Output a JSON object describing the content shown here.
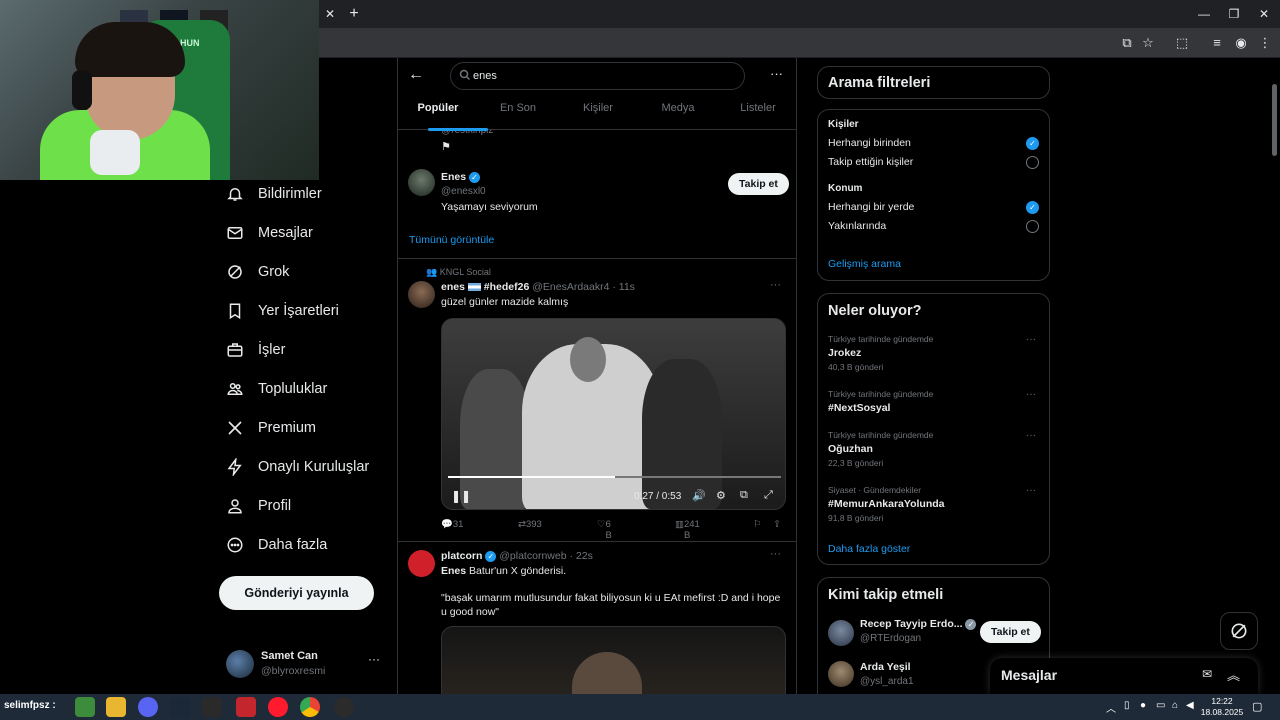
{
  "search": {
    "query": "enes"
  },
  "tabs": [
    "Popüler",
    "En Son",
    "Kişiler",
    "Medya",
    "Listeler"
  ],
  "nav": {
    "items": [
      {
        "label": "Bildirimler",
        "icon": "bell-icon"
      },
      {
        "label": "Mesajlar",
        "icon": "mail-icon"
      },
      {
        "label": "Grok",
        "icon": "grok-icon"
      },
      {
        "label": "Yer İşaretleri",
        "icon": "bookmark-icon"
      },
      {
        "label": "İşler",
        "icon": "briefcase-icon"
      },
      {
        "label": "Topluluklar",
        "icon": "communities-icon"
      },
      {
        "label": "Premium",
        "icon": "x-logo-icon"
      },
      {
        "label": "Onaylı Kuruluşlar",
        "icon": "lightning-icon"
      },
      {
        "label": "Profil",
        "icon": "person-icon"
      },
      {
        "label": "Daha fazla",
        "icon": "more-circle-icon"
      }
    ],
    "post_button": "Gönderiyi yayınla",
    "account": {
      "name": "Samet Can",
      "handle": "@blyroxresmi"
    }
  },
  "people_results": {
    "partial_handle": "@restkinplz",
    "user": {
      "name": "Enes",
      "handle": "@enesxl0",
      "bio": "Yaşamayı seviyorum",
      "follow_label": "Takip et"
    },
    "show_all": "Tümünü görüntüle"
  },
  "post1": {
    "community": "KNGL Social",
    "author": "enes",
    "hashtag": "#hedef26",
    "handle": "@EnesArdaakr4",
    "time": "11s",
    "text": "güzel günler mazide kalmış",
    "video": {
      "time": "0:27 / 0:53",
      "progress": 0.5
    },
    "stats": {
      "replies": "31",
      "reposts": "393",
      "likes": "6 B",
      "views": "241 B"
    }
  },
  "post2": {
    "author": "platcorn",
    "handle": "@platcornweb",
    "time": "22s",
    "reply_author": "Enes",
    "reply_context": "Batur'un X gönderisi.",
    "text": "\"başak umarım mutlusundur fakat biliyosun ki u EAt mefirst :D  and i hope u good now\""
  },
  "filters": {
    "title": "Arama filtreleri",
    "people_heading": "Kişiler",
    "people_options": [
      {
        "label": "Herhangi birinden",
        "selected": true
      },
      {
        "label": "Takip ettiğin kişiler",
        "selected": false
      }
    ],
    "location_heading": "Konum",
    "location_options": [
      {
        "label": "Herhangi bir yerde",
        "selected": true
      },
      {
        "label": "Yakınlarında",
        "selected": false
      }
    ],
    "advanced": "Gelişmiş arama"
  },
  "trends": {
    "title": "Neler oluyor?",
    "items": [
      {
        "category": "Türkiye tarihinde gündemde",
        "name": "Jrokez",
        "count": "40,3 B gönderi"
      },
      {
        "category": "Türkiye tarihinde gündemde",
        "name": "#NextSosyal",
        "count": ""
      },
      {
        "category": "Türkiye tarihinde gündemde",
        "name": "Oğuzhan",
        "count": "22,3 B gönderi"
      },
      {
        "category": "Siyaset · Gündemdekiler",
        "name": "#MemurAnkaraYolunda",
        "count": "91,8 B gönderi"
      }
    ],
    "show_more": "Daha fazla göster"
  },
  "who_to_follow": {
    "title": "Kimi takip etmeli",
    "users": [
      {
        "name": "Recep Tayyip Erdo...",
        "handle": "@RTErdogan",
        "follow_label": "Takip et"
      },
      {
        "name": "Arda Yeşil",
        "handle": "@ysl_arda1"
      }
    ]
  },
  "messages_drawer": {
    "title": "Mesajlar"
  },
  "webcam": {
    "label": "HUN"
  },
  "taskbar": {
    "user_label": "selimfpsz :",
    "time": "12:22",
    "date": "18.08.2025"
  },
  "colors": {
    "accent": "#1d9bf0",
    "background": "#000000",
    "border": "#2f3336",
    "muted": "#71767b"
  }
}
